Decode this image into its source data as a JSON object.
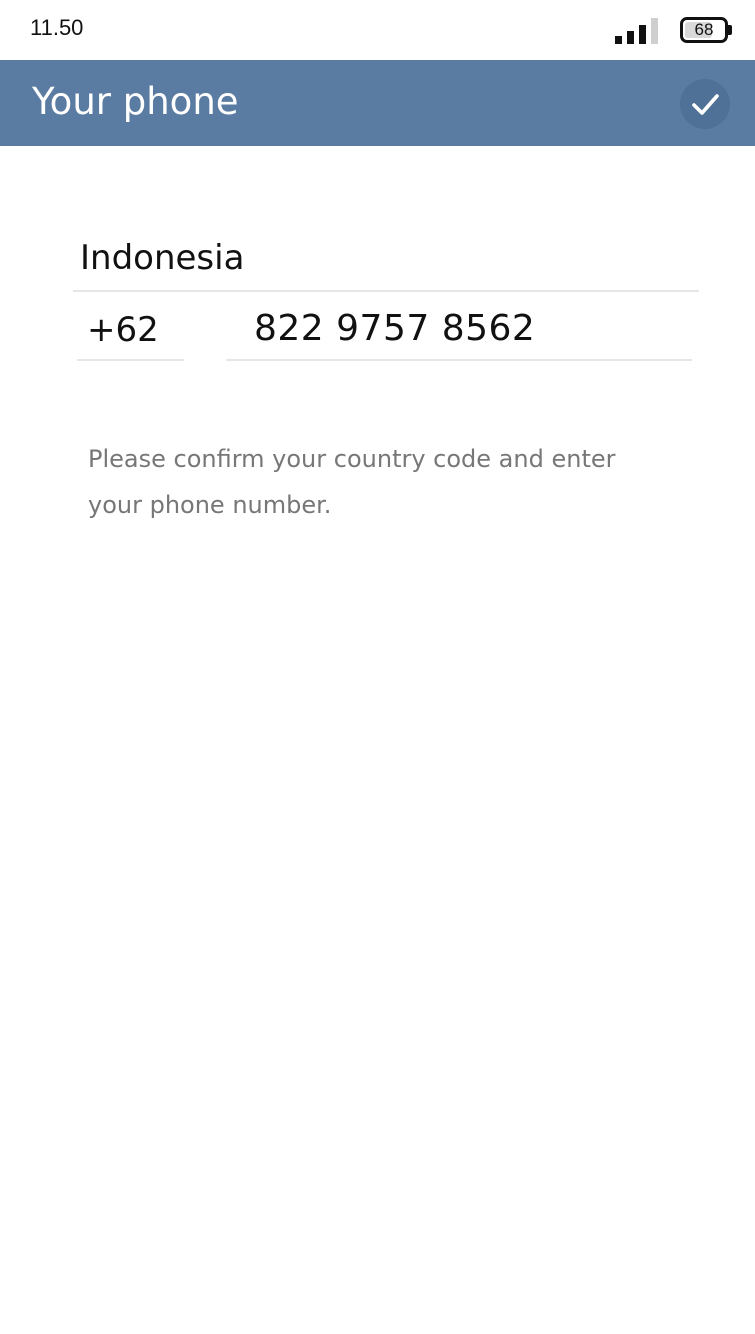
{
  "status_bar": {
    "time": "11.50",
    "signal_icon": "signal-strength-icon",
    "battery_icon": "battery-icon",
    "battery_level": "68"
  },
  "app_bar": {
    "title": "Your phone",
    "done_icon": "checkmark-icon",
    "background_color": "#5b7ca2"
  },
  "form": {
    "country": "Indonesia",
    "country_code": "+62",
    "phone_number": "822 9757 8562",
    "hint": "Please confirm your country code and enter your phone number."
  }
}
